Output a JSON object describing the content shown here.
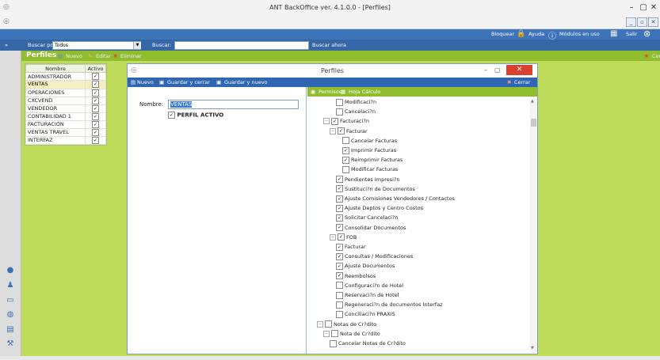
{
  "window": {
    "title": "ANT BackOffice ver. 4.1.0.0 - [Perfiles]"
  },
  "topbar": {
    "bloquear": "Bloquear",
    "ayuda": "Ayuda",
    "modulos": "Módulos en uso",
    "salir": "Salir"
  },
  "search": {
    "by_label": "Buscar por:",
    "by_value": "Todos",
    "buscar_label": "Buscar:",
    "buscar_value": "",
    "now_button": "Buscar ahora"
  },
  "module": {
    "title": "Perfiles",
    "nuevo": "Nuevo",
    "editar": "Editar",
    "eliminar": "Eliminar",
    "cerrar": "Cerrar"
  },
  "profiles": {
    "headers": {
      "name": "Nombre",
      "active": "Activo"
    },
    "rows": [
      {
        "name": "ADMINISTRADOR",
        "active": "✓"
      },
      {
        "name": "VENTAS",
        "active": "✓"
      },
      {
        "name": "OPERACIONES",
        "active": "✓"
      },
      {
        "name": "CXCVEND",
        "active": "✓"
      },
      {
        "name": "VENDEDOR",
        "active": "✓"
      },
      {
        "name": "CONTABILIDAD 1",
        "active": "✓"
      },
      {
        "name": "FACTURACION",
        "active": "✓"
      },
      {
        "name": "VENTAS TRAVEL",
        "active": "✓"
      },
      {
        "name": "INTERFAZ",
        "active": "✓"
      }
    ]
  },
  "dialog": {
    "title": "Perfiles",
    "toolbar": {
      "nuevo": "Nuevo",
      "guardar_cerrar": "Guardar y cerrar",
      "guardar_nuevo": "Guardar y nuevo",
      "cerrar": "Cerrar"
    },
    "form": {
      "nombre_label": "Nombre:",
      "nombre_value": "VENTAS",
      "perfil_activo": "PERFIL ACTIVO",
      "perfil_activo_check": "✓"
    },
    "tree_tabs": {
      "permisos": "Permisos",
      "hoja_calculo": "Hoja Cálculo"
    },
    "tree": [
      {
        "label": "Modificaci?n",
        "check": ""
      },
      {
        "label": "Cancelaci?n",
        "check": ""
      },
      {
        "label": "Facturaci?n",
        "check": "✓"
      },
      {
        "label": "Facturar",
        "check": "✓"
      },
      {
        "label": "Cancelar Facturas",
        "check": ""
      },
      {
        "label": "Imprimir Facturas",
        "check": "✓"
      },
      {
        "label": "Reimprimir Facturas",
        "check": "✓"
      },
      {
        "label": "Modificar Facturas",
        "check": ""
      },
      {
        "label": "Pendientes Impresi?n",
        "check": "✓"
      },
      {
        "label": "Sustituci?n de Documentos",
        "check": "✓"
      },
      {
        "label": "Ajuste Comisiones Vendedores / Contactos",
        "check": "✓"
      },
      {
        "label": "Ajuste Deptos y Centro Costos",
        "check": "✓"
      },
      {
        "label": "Solicitar Cancelaci?n",
        "check": "✓"
      },
      {
        "label": "Consolidar Documentos",
        "check": "✓"
      },
      {
        "label": "FOB",
        "check": "✓"
      },
      {
        "label": "Facturar",
        "check": "✓"
      },
      {
        "label": "Consultas / Modificaciones",
        "check": "✓"
      },
      {
        "label": "Ajuste Documentos",
        "check": "✓"
      },
      {
        "label": "Reembolsos",
        "check": "✓"
      },
      {
        "label": "Configuraci?n de Hotel",
        "check": ""
      },
      {
        "label": "Reservaci?n de Hotel",
        "check": ""
      },
      {
        "label": "Regeneraci?n de documentos Interfaz",
        "check": ""
      },
      {
        "label": "Conciliaci?n PRAXIS",
        "check": ""
      },
      {
        "label": "Notas de Cr?dito",
        "check": ""
      },
      {
        "label": "Nota de Cr?dito",
        "check": ""
      },
      {
        "label": "Cancelar Notas de Cr?dito",
        "check": ""
      }
    ]
  }
}
